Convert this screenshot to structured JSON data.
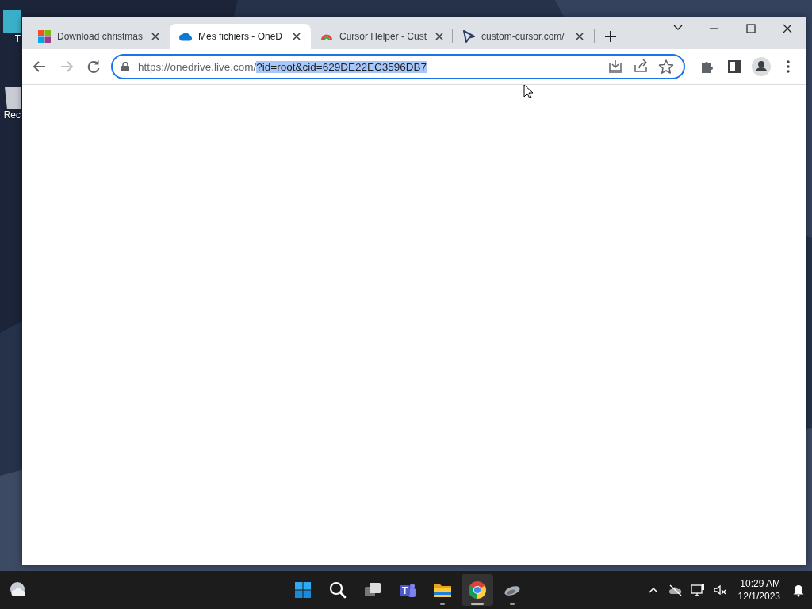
{
  "desktop": {
    "icons": [
      {
        "label": "T"
      },
      {
        "label": "Rec"
      }
    ]
  },
  "browser": {
    "tabs": [
      {
        "title": "Download christmas",
        "kind": "grid",
        "selected": false
      },
      {
        "title": "Mes fichiers - OneD",
        "kind": "cloud",
        "selected": true
      },
      {
        "title": "Cursor Helper - Cust",
        "kind": "rainbow",
        "selected": false
      },
      {
        "title": "custom-cursor.com/",
        "kind": "cursor",
        "selected": false
      }
    ],
    "address": {
      "url_plain": "https://onedrive.live.com/",
      "url_selected": "?id=root&cid=629DE22EC3596DB7"
    }
  },
  "taskbar": {
    "apps": [
      {
        "kind": "start",
        "running": false,
        "selected": false
      },
      {
        "kind": "search",
        "running": false,
        "selected": false
      },
      {
        "kind": "taskview",
        "running": false,
        "selected": false
      },
      {
        "kind": "teams",
        "running": false,
        "selected": false
      },
      {
        "kind": "explorer",
        "running": true,
        "selected": false
      },
      {
        "kind": "chrome",
        "running": true,
        "selected": true
      },
      {
        "kind": "mouse",
        "running": true,
        "selected": false
      }
    ],
    "time": "10:29 AM",
    "date": "12/1/2023"
  }
}
